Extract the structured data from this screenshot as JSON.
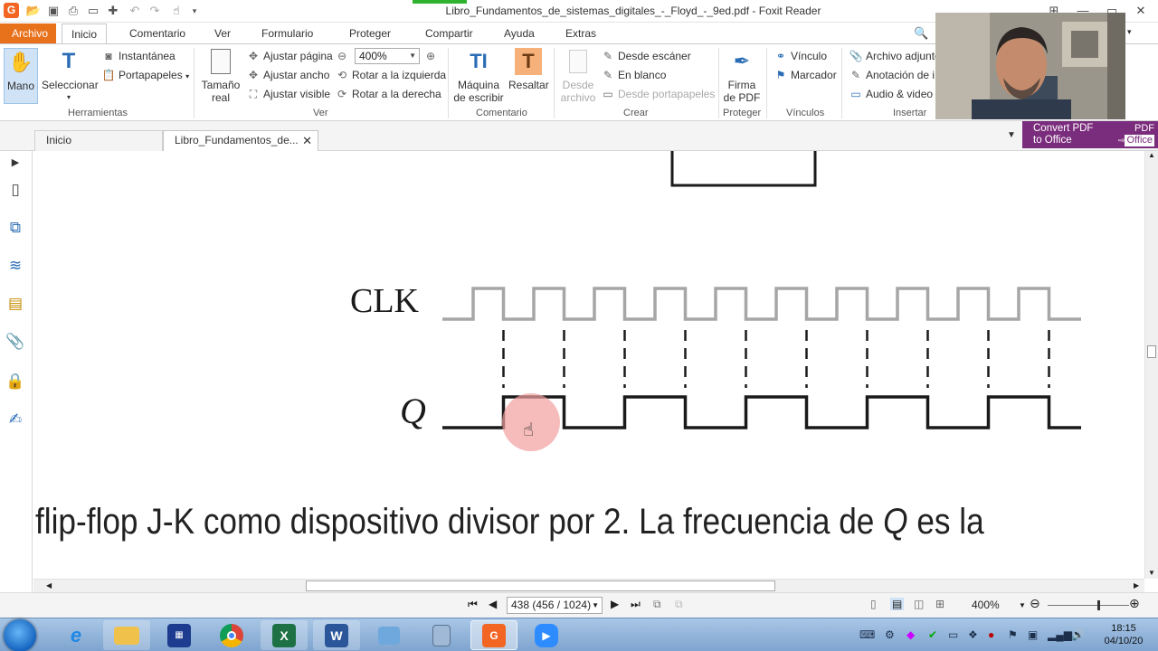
{
  "window": {
    "title": "Libro_Fundamentos_de_sistemas_digitales_-_Floyd_-_9ed.pdf - Foxit Reader",
    "app_logo": "G"
  },
  "menu": {
    "tabs": [
      "Archivo",
      "Inicio",
      "Comentario",
      "Ver",
      "Formulario",
      "Proteger",
      "Compartir",
      "Ayuda",
      "Extras"
    ],
    "active": "Inicio"
  },
  "ribbon": {
    "herramientas": {
      "label": "Herramientas",
      "mano": "Mano",
      "seleccionar": "Seleccionar",
      "instantanea": "Instantánea",
      "portapapeles": "Portapapeles"
    },
    "ver": {
      "label": "Ver",
      "tamano_real_1": "Tamaño",
      "tamano_real_2": "real",
      "ajustar_pagina": "Ajustar página",
      "ajustar_ancho": "Ajustar ancho",
      "ajustar_visible": "Ajustar visible",
      "zoom_value": "400%",
      "rotar_izq": "Rotar a la izquierda",
      "rotar_der": "Rotar a la derecha"
    },
    "comentario": {
      "label": "Comentario",
      "maquina_1": "Máquina",
      "maquina_2": "de escribir",
      "resaltar": "Resaltar"
    },
    "crear": {
      "label": "Crear",
      "desde_archivo_1": "Desde",
      "desde_archivo_2": "archivo",
      "desde_escaner": "Desde escáner",
      "en_blanco": "En blanco",
      "desde_portapapeles": "Desde portapapeles"
    },
    "proteger": {
      "label": "Proteger",
      "firma_1": "Firma",
      "firma_2": "de PDF"
    },
    "vinculos": {
      "label": "Vínculos",
      "vinculo": "Vínculo",
      "marcador": "Marcador"
    },
    "insertar": {
      "label": "Insertar",
      "archivo_adjunto": "Archivo adjunto",
      "anotacion": "Anotación de i",
      "audio_video": "Audio & video"
    }
  },
  "doc_tabs": {
    "home": "Inicio",
    "file": "Libro_Fundamentos_de..."
  },
  "promo": {
    "line1": "Convert PDF",
    "line2": "to Office",
    "pdf": "PDF",
    "office": "Office"
  },
  "page": {
    "clk_label": "CLK",
    "q_label": "Q",
    "caption_part1": "flip-flop J-K como dispositivo divisor por 2. La frecuencia de ",
    "caption_q": "Q",
    "caption_part2": " es la"
  },
  "status": {
    "page_indicator": "438 (456 / 1024)",
    "zoom": "400%"
  },
  "taskbar": {
    "time": "18:15",
    "date": "04/10/20"
  },
  "colors": {
    "accent_orange": "#e8711c",
    "promo_purple": "#7b2d7d",
    "clk_gray": "#a6a6a6",
    "q_black": "#1a1a1a"
  }
}
